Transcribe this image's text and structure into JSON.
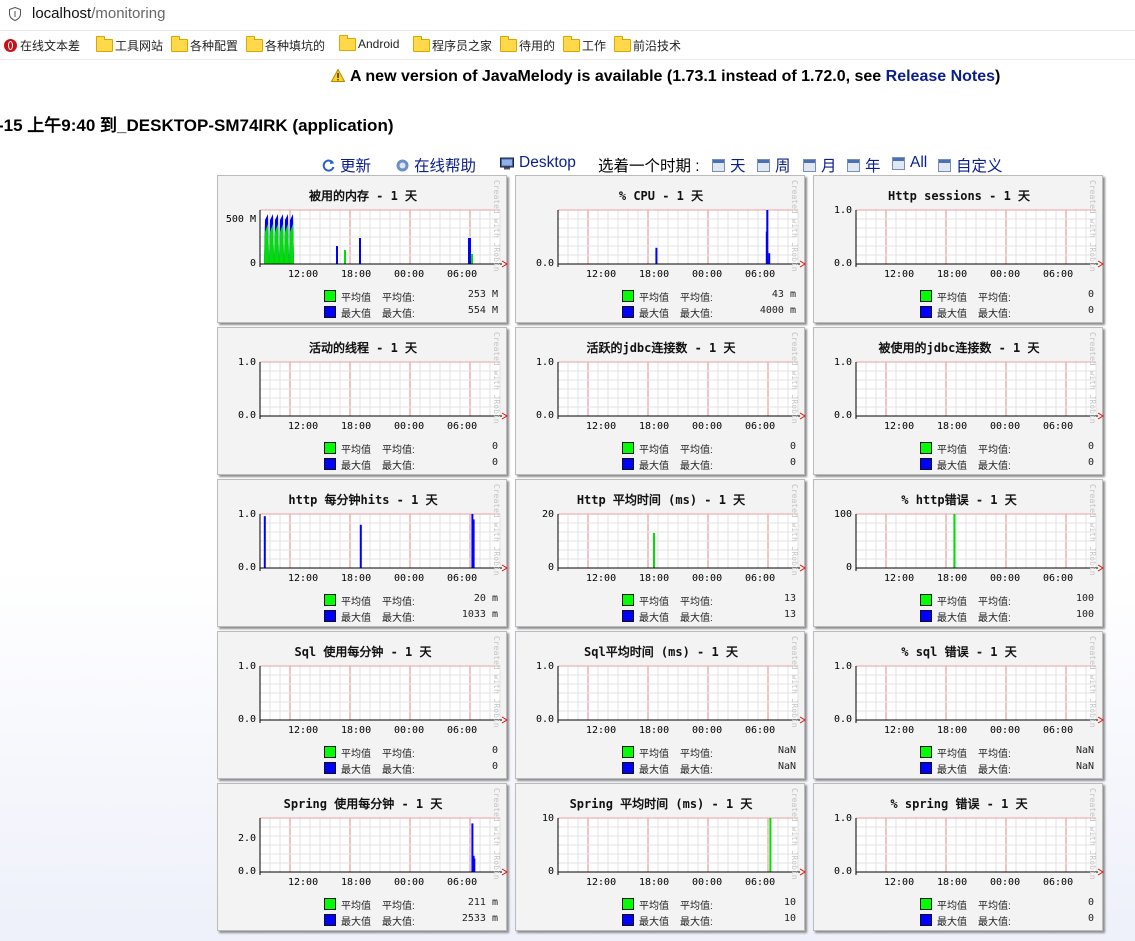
{
  "browser": {
    "url_host": "localhost",
    "url_path": "/monitoring",
    "bookmarks": [
      {
        "label": "在线文本差",
        "icon": "opera-icon"
      },
      {
        "label": "工具网站",
        "icon": "folder-icon"
      },
      {
        "label": "各种配置",
        "icon": "folder-icon"
      },
      {
        "label": "各种填坑的",
        "icon": "folder-icon"
      },
      {
        "label": "Android",
        "icon": "folder-icon"
      },
      {
        "label": "程序员之家",
        "icon": "folder-icon"
      },
      {
        "label": "待用的",
        "icon": "folder-icon"
      },
      {
        "label": "工作",
        "icon": "folder-icon"
      },
      {
        "label": "前沿技术",
        "icon": "folder-icon"
      }
    ]
  },
  "notice": {
    "text": "A new version of JavaMelody is available (1.73.1 instead of 1.72.0, see ",
    "link": "Release Notes",
    "suffix": ")"
  },
  "page_title": "-15 上午9:40 到_DESKTOP-SM74IRK (application)",
  "toolbar": {
    "refresh": "更新",
    "help": "在线帮助",
    "desktop": "Desktop",
    "period_label": "选着一个时期 :",
    "periods": [
      "天",
      "周",
      "月",
      "年",
      "All",
      "自定义"
    ]
  },
  "legend": {
    "avg_name": "平均值",
    "avg_label": "平均值:",
    "max_name": "最大值",
    "max_label": "最大值:"
  },
  "colors": {
    "avg": "#00ff00",
    "max": "#0000ff",
    "grid": "#e8a0a0",
    "arrow": "#ff0000"
  },
  "x_ticks": [
    "12:00",
    "18:00",
    "00:00",
    "06:00"
  ],
  "side_text": "Created with JRobin",
  "charts": [
    {
      "title": "被用的内存 - 1 天",
      "yticks": [
        "500 M",
        "0"
      ],
      "avg": "253 M",
      "max": "554 M"
    },
    {
      "title": "% CPU - 1 天",
      "yticks": [
        "0.0"
      ],
      "avg": "43 m",
      "max": "4000 m"
    },
    {
      "title": "Http sessions - 1 天",
      "yticks": [
        "1.0",
        "0.0"
      ],
      "avg": "0",
      "max": "0"
    },
    {
      "title": "活动的线程 - 1 天",
      "yticks": [
        "1.0",
        "0.0"
      ],
      "avg": "0",
      "max": "0"
    },
    {
      "title": "活跃的jdbc连接数 - 1 天",
      "yticks": [
        "1.0",
        "0.0"
      ],
      "avg": "0",
      "max": "0"
    },
    {
      "title": "被使用的jdbc连接数 - 1 天",
      "yticks": [
        "1.0",
        "0.0"
      ],
      "avg": "0",
      "max": "0"
    },
    {
      "title": "http 每分钟hits - 1 天",
      "yticks": [
        "1.0",
        "0.0"
      ],
      "avg": "20 m",
      "max": "1033 m"
    },
    {
      "title": "Http 平均时间 (ms) - 1 天",
      "yticks": [
        "20",
        "0"
      ],
      "avg": "13",
      "max": "13"
    },
    {
      "title": "% http错误 - 1 天",
      "yticks": [
        "100",
        "0"
      ],
      "avg": "100",
      "max": "100"
    },
    {
      "title": "Sql 使用每分钟 - 1 天",
      "yticks": [
        "1.0",
        "0.0"
      ],
      "avg": "0",
      "max": "0"
    },
    {
      "title": "Sql平均时间 (ms) - 1 天",
      "yticks": [
        "1.0",
        "0.0"
      ],
      "avg": "NaN",
      "max": "NaN"
    },
    {
      "title": "% sql 错误 - 1 天",
      "yticks": [
        "1.0",
        "0.0"
      ],
      "avg": "NaN",
      "max": "NaN"
    },
    {
      "title": "Spring 使用每分钟 - 1 天",
      "yticks": [
        "2.0",
        "0.0"
      ],
      "avg": "211 m",
      "max": "2533 m"
    },
    {
      "title": "Spring 平均时间 (ms) - 1 天",
      "yticks": [
        "10",
        "0"
      ],
      "avg": "10",
      "max": "10"
    },
    {
      "title": "% spring 错误 - 1 天",
      "yticks": [
        "1.0",
        "0.0"
      ],
      "avg": "0",
      "max": "0"
    }
  ]
}
